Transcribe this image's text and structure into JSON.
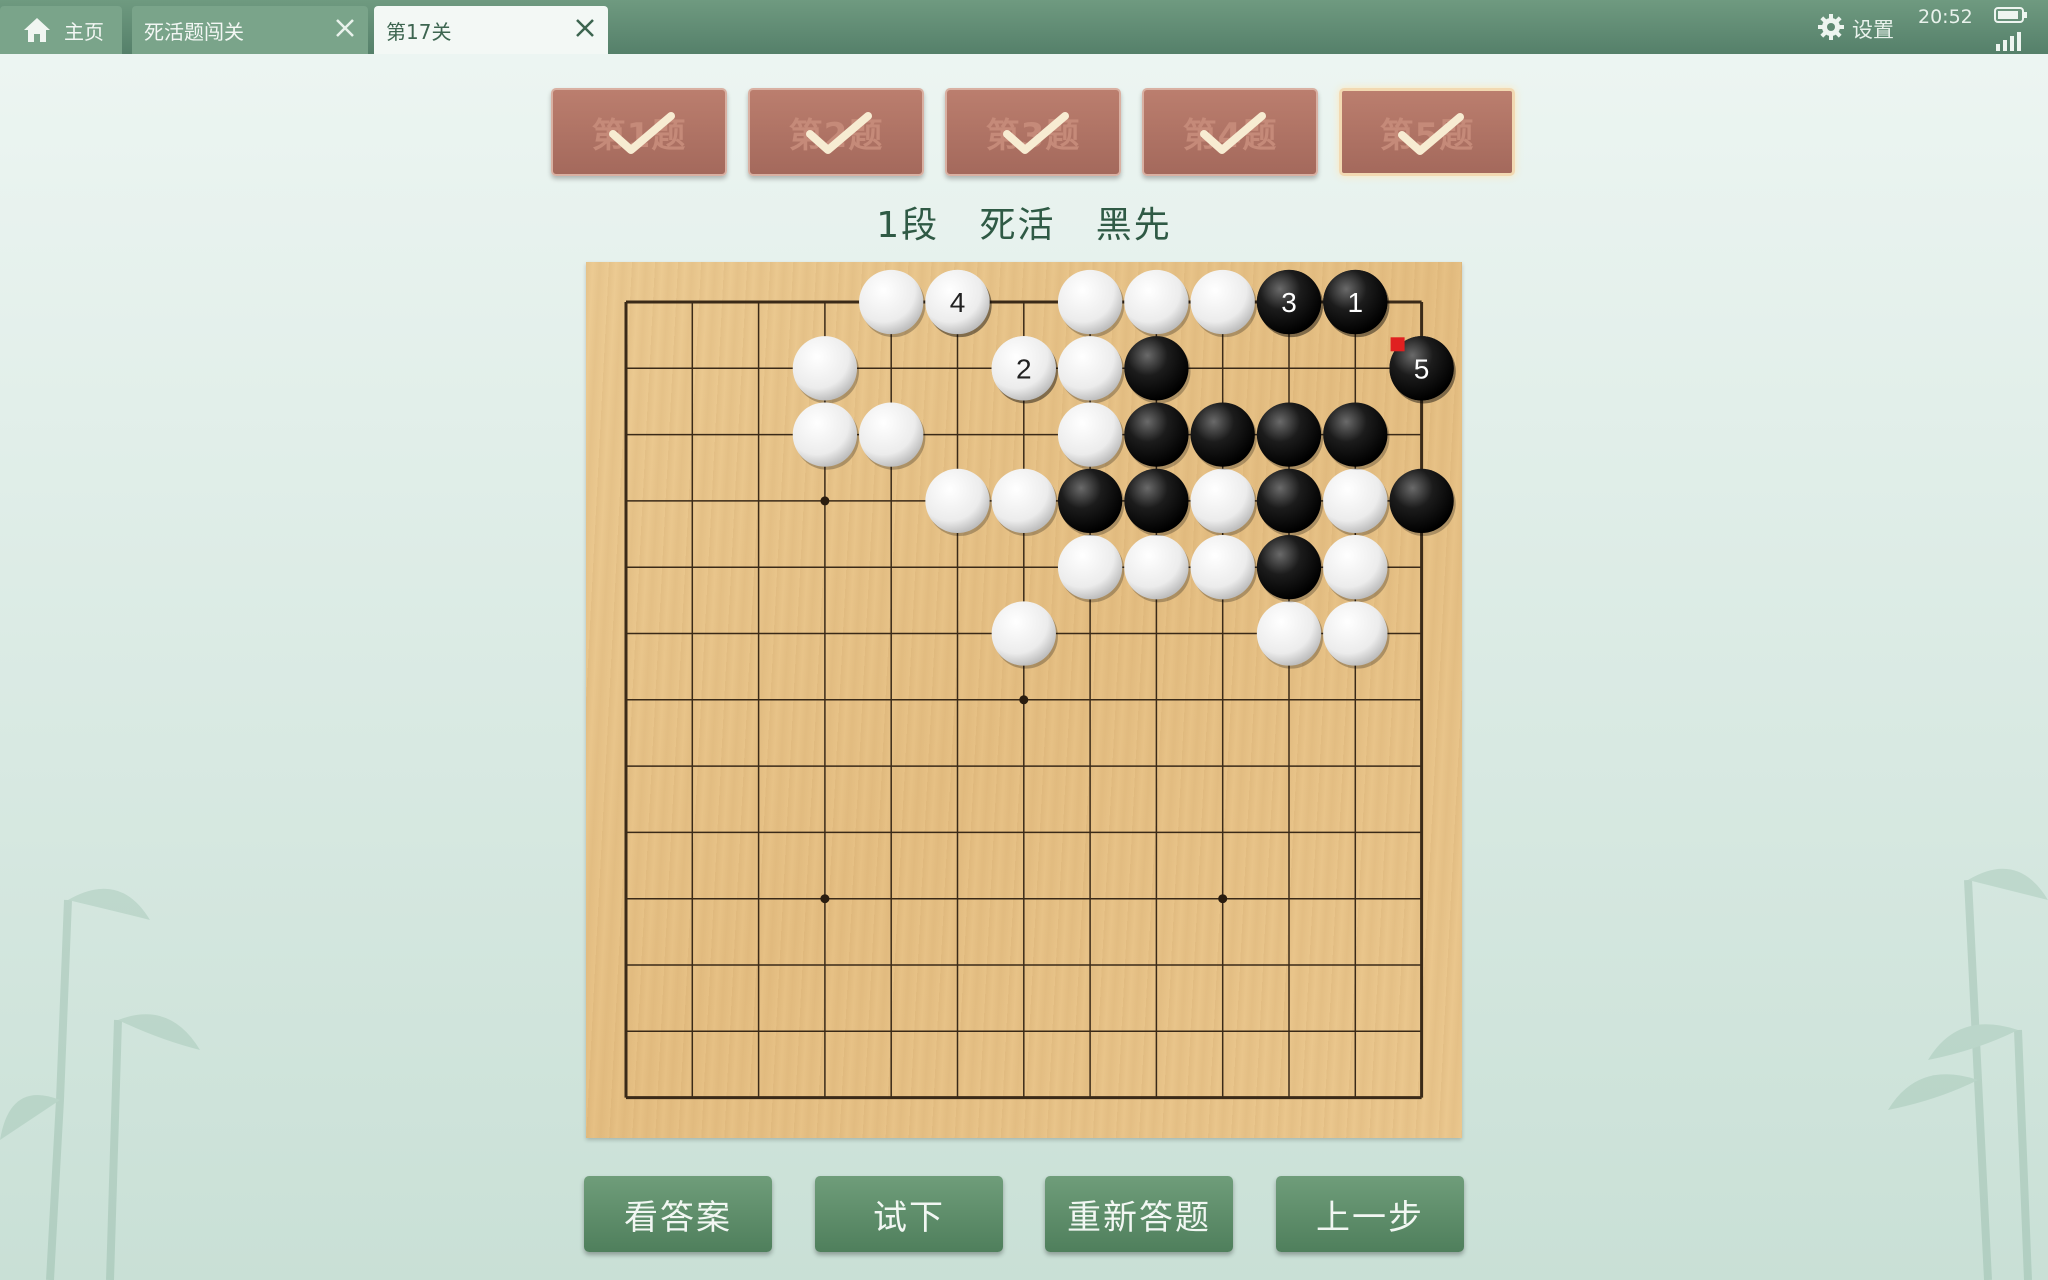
{
  "tabs": [
    {
      "label": "主页",
      "icon": "home-icon",
      "active": false
    },
    {
      "label": "死活题闯关",
      "closable": true,
      "active": false
    },
    {
      "label": "第17关",
      "closable": true,
      "active": true
    }
  ],
  "status": {
    "settings_label": "设置",
    "time": "20:52"
  },
  "problems": [
    {
      "label": "第1题",
      "solved": true
    },
    {
      "label": "第2题",
      "solved": true
    },
    {
      "label": "第3题",
      "solved": true
    },
    {
      "label": "第4题",
      "solved": true
    },
    {
      "label": "第5题",
      "solved": true,
      "current": true
    }
  ],
  "problem_info": {
    "text": "1段   死活   黑先"
  },
  "board": {
    "size": 13,
    "star_points": [
      [
        3,
        3
      ],
      [
        3,
        9
      ],
      [
        6,
        6
      ],
      [
        9,
        3
      ],
      [
        9,
        9
      ]
    ],
    "white_stones": [
      [
        4,
        0
      ],
      [
        5,
        0
      ],
      [
        7,
        0
      ],
      [
        8,
        0
      ],
      [
        9,
        0
      ],
      [
        3,
        1
      ],
      [
        6,
        1
      ],
      [
        7,
        1
      ],
      [
        3,
        2
      ],
      [
        4,
        2
      ],
      [
        7,
        2
      ],
      [
        5,
        3
      ],
      [
        6,
        3
      ],
      [
        9,
        3
      ],
      [
        11,
        3
      ],
      [
        7,
        4
      ],
      [
        8,
        4
      ],
      [
        9,
        4
      ],
      [
        11,
        4
      ],
      [
        6,
        5
      ],
      [
        10,
        5
      ],
      [
        11,
        5
      ]
    ],
    "black_stones": [
      [
        10,
        0
      ],
      [
        11,
        0
      ],
      [
        8,
        1
      ],
      [
        12,
        1
      ],
      [
        8,
        2
      ],
      [
        9,
        2
      ],
      [
        10,
        2
      ],
      [
        11,
        2
      ],
      [
        7,
        3
      ],
      [
        8,
        3
      ],
      [
        10,
        3
      ],
      [
        12,
        3
      ],
      [
        10,
        4
      ]
    ],
    "numbered_moves": [
      {
        "n": "1",
        "color": "black",
        "col": 11,
        "row": 0
      },
      {
        "n": "2",
        "color": "white",
        "col": 6,
        "row": 1
      },
      {
        "n": "3",
        "color": "black",
        "col": 10,
        "row": 0
      },
      {
        "n": "4",
        "color": "white",
        "col": 5,
        "row": 0
      },
      {
        "n": "5",
        "color": "black",
        "col": 12,
        "row": 1
      }
    ],
    "last_move_marker_color": "#e02020"
  },
  "actions": [
    {
      "label": "看答案"
    },
    {
      "label": "试下"
    },
    {
      "label": "重新答题"
    },
    {
      "label": "上一步"
    }
  ],
  "colors": {
    "accent_green": "#4f7f5c",
    "problem_button": "#a4695c",
    "board": "#e6c084"
  }
}
